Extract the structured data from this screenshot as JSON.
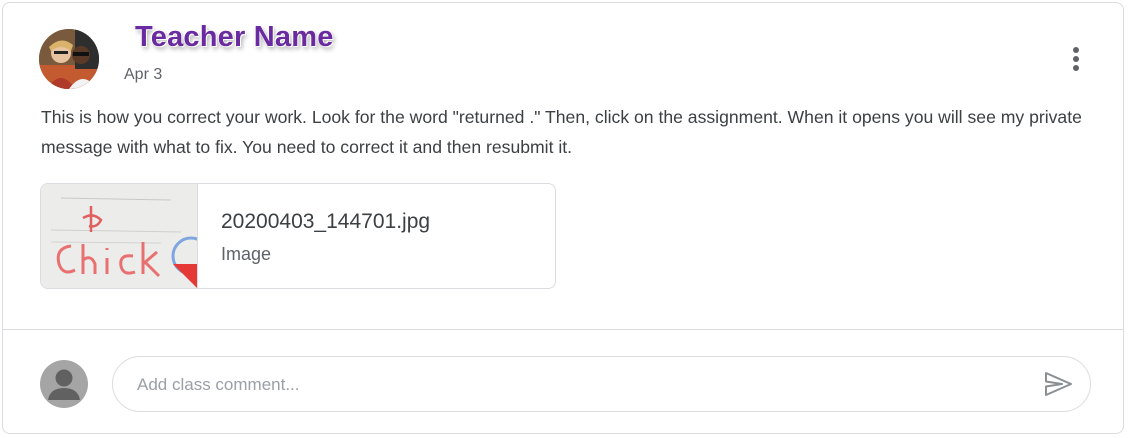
{
  "post": {
    "author": "Teacher Name",
    "date": "Apr 3",
    "body": "This is how you correct your work. Look for the word \"returned .\" Then, click on the assignment. When it opens you will see my private message with what to fix. You need to correct it and then resubmit it."
  },
  "attachment": {
    "filename": "20200403_144701.jpg",
    "type": "Image"
  },
  "comment": {
    "placeholder": "Add class comment..."
  },
  "icons": {
    "more": "more-vert-icon",
    "send": "send-icon",
    "user": "person-icon"
  },
  "colors": {
    "author_name": "#6a2aa0",
    "border": "#dadce0",
    "text": "#3c4043",
    "secondary_text": "#5f6368"
  }
}
